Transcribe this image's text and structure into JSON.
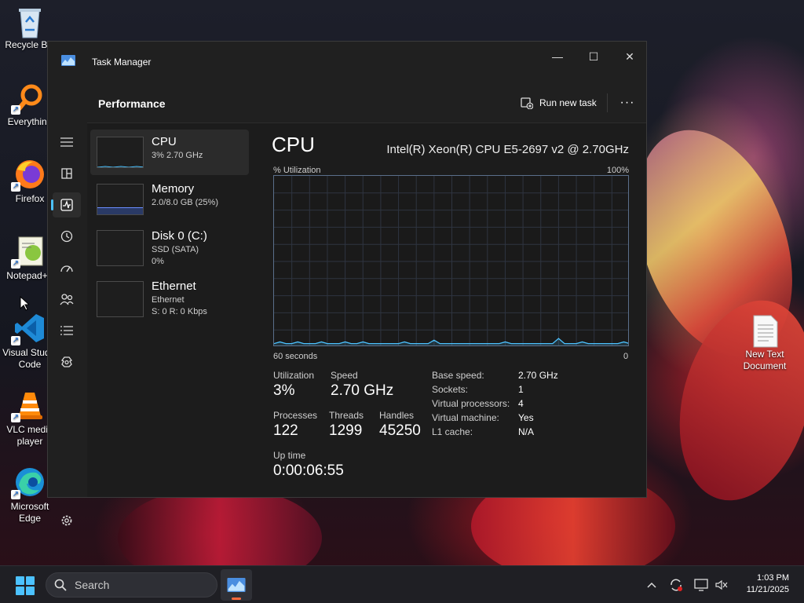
{
  "desktop": {
    "icons": [
      {
        "label": "Recycle Bin",
        "icon": "recycle-bin-icon"
      },
      {
        "label": "Everything",
        "icon": "everything-search-icon"
      },
      {
        "label": "Firefox",
        "icon": "firefox-icon"
      },
      {
        "label": "Notepad++",
        "icon": "notepad-plus-plus-icon"
      },
      {
        "label": "Visual Studio Code",
        "icon": "vscode-icon"
      },
      {
        "label": "VLC media player",
        "icon": "vlc-icon"
      },
      {
        "label": "Microsoft Edge",
        "icon": "edge-icon"
      },
      {
        "label": "New Text Document",
        "icon": "text-document-icon"
      }
    ]
  },
  "window": {
    "title": "Task Manager",
    "controls": {
      "minimize": "—",
      "maximize": "☐",
      "close": "✕"
    }
  },
  "header": {
    "page_title": "Performance",
    "run_new_task": "Run new task",
    "more": "···"
  },
  "nav": [
    "hamburger-menu-icon",
    "processes-icon",
    "performance-icon",
    "app-history-icon",
    "startup-apps-icon",
    "users-icon",
    "details-icon",
    "services-icon",
    "settings-icon"
  ],
  "resources": [
    {
      "name": "CPU",
      "sub1": "3% 2.70 GHz",
      "sub2": ""
    },
    {
      "name": "Memory",
      "sub1": "2.0/8.0 GB (25%)",
      "sub2": ""
    },
    {
      "name": "Disk 0 (C:)",
      "sub1": "SSD (SATA)",
      "sub2": "0%"
    },
    {
      "name": "Ethernet",
      "sub1": "Ethernet",
      "sub2": "S: 0 R: 0 Kbps"
    }
  ],
  "detail": {
    "title": "CPU",
    "model": "Intel(R) Xeon(R) CPU E5-2697 v2 @ 2.70GHz",
    "graph": {
      "y_label": "% Utilization",
      "y_max_label": "100%",
      "x_left_label": "60 seconds",
      "x_right_label": "0",
      "line_color": "#4cc2ff",
      "samples": [
        2,
        3,
        2,
        2,
        3,
        2,
        2,
        2,
        3,
        2,
        2,
        2,
        3,
        2,
        2,
        3,
        2,
        2,
        2,
        2,
        2,
        2,
        3,
        2,
        2,
        2,
        2,
        4,
        2,
        2,
        2,
        2,
        2,
        2,
        2,
        2,
        2,
        2,
        2,
        3,
        2,
        2,
        2,
        2,
        2,
        2,
        2,
        2,
        5,
        2,
        2,
        2,
        3,
        2,
        2,
        2,
        2,
        2,
        2,
        3,
        2
      ]
    },
    "stats": {
      "utilization_label": "Utilization",
      "utilization": "3%",
      "speed_label": "Speed",
      "speed": "2.70 GHz",
      "processes_label": "Processes",
      "processes": "122",
      "threads_label": "Threads",
      "threads": "1299",
      "handles_label": "Handles",
      "handles": "45250",
      "uptime_label": "Up time",
      "uptime": "0:00:06:55"
    },
    "specs": [
      {
        "key": "Base speed:",
        "value": "2.70 GHz"
      },
      {
        "key": "Sockets:",
        "value": "1"
      },
      {
        "key": "Virtual processors:",
        "value": "4"
      },
      {
        "key": "Virtual machine:",
        "value": "Yes"
      },
      {
        "key": "L1 cache:",
        "value": "N/A"
      }
    ]
  },
  "taskbar": {
    "search_placeholder": "Search",
    "time": "1:03 PM",
    "date": "11/21/2025",
    "tray_icons": [
      "chevron-up-icon",
      "sync-icon",
      "display-icon",
      "volume-muted-icon"
    ]
  }
}
